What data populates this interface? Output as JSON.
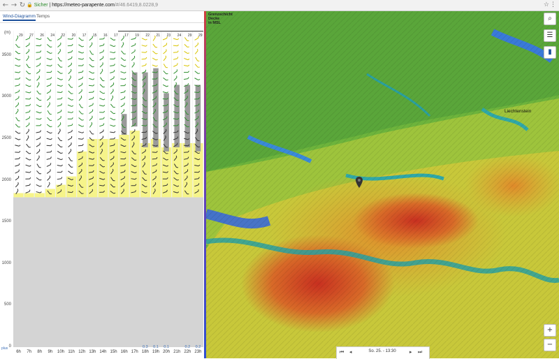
{
  "browser": {
    "secure_label": "Sicher",
    "url_host": "https://meteo-parapente.com",
    "url_path": "/#/46.6419,8.0228,9"
  },
  "left_panel": {
    "tabs": [
      "Wind-Diagramm",
      "Temps"
    ],
    "active_tab": "Wind-Diagramm",
    "unit": "(m)",
    "y_labels": [
      "3500",
      "3000",
      "2500",
      "2000",
      "1500",
      "1000",
      "500",
      "0"
    ],
    "plus_label": "plus",
    "hours": [
      "6h",
      "7h",
      "8h",
      "9h",
      "10h",
      "11h",
      "12h",
      "13h",
      "14h",
      "15h",
      "16h",
      "17h",
      "18h",
      "19h",
      "20h",
      "21h",
      "22h",
      "23h"
    ],
    "rain": [
      "",
      "",
      "",
      "",
      "",
      "",
      "",
      "",
      "",
      "",
      "",
      "",
      "0.3",
      "0.1",
      "0.1",
      "",
      "0.2",
      "0.2"
    ],
    "colors": {
      "thermal": "#f6f48a",
      "cloud": "#9a9a9a",
      "ground": "#d4d4d4",
      "barb_green": "#2f8f2f",
      "barb_dark": "#333333",
      "barb_yellow": "#d8c400"
    }
  },
  "chart_data": {
    "type": "wind-diagram",
    "x": [
      "6h",
      "7h",
      "8h",
      "9h",
      "10h",
      "11h",
      "12h",
      "13h",
      "14h",
      "15h",
      "16h",
      "17h",
      "18h",
      "19h",
      "20h",
      "21h",
      "22h",
      "23h"
    ],
    "ylabel": "(m)",
    "ylim": [
      0,
      3800
    ],
    "terrain_height_m": 1800,
    "thermal_top_m": [
      1850,
      1850,
      1850,
      1900,
      1950,
      2050,
      2350,
      2500,
      2500,
      2500,
      2550,
      2600,
      2450,
      2500,
      2400,
      2450,
      2450,
      2450
    ],
    "cloud_base_m": [
      null,
      null,
      null,
      null,
      null,
      null,
      null,
      null,
      null,
      null,
      2550,
      2650,
      2400,
      2400,
      2350,
      2400,
      2400,
      2350
    ],
    "cloud_top_m": [
      null,
      null,
      null,
      null,
      null,
      null,
      null,
      null,
      null,
      null,
      2800,
      3300,
      3300,
      3350,
      3050,
      3150,
      3150,
      3150
    ],
    "wind_speed_top_row_kmh": [
      29,
      27,
      26,
      24,
      22,
      20,
      17,
      15,
      16,
      17,
      17,
      19,
      22,
      21,
      23,
      24,
      29,
      29
    ]
  },
  "map": {
    "legend_lines": [
      "Grenzschicht",
      "Decke",
      "in MSL"
    ],
    "labels": [
      "Liechtenstein"
    ],
    "time_display": "So. 25. - 13:30",
    "buttons": {
      "search": "search-icon",
      "settings": "sliders-icon",
      "chart": "bar-chart-icon",
      "zoom_in": "+",
      "zoom_out": "−"
    }
  }
}
